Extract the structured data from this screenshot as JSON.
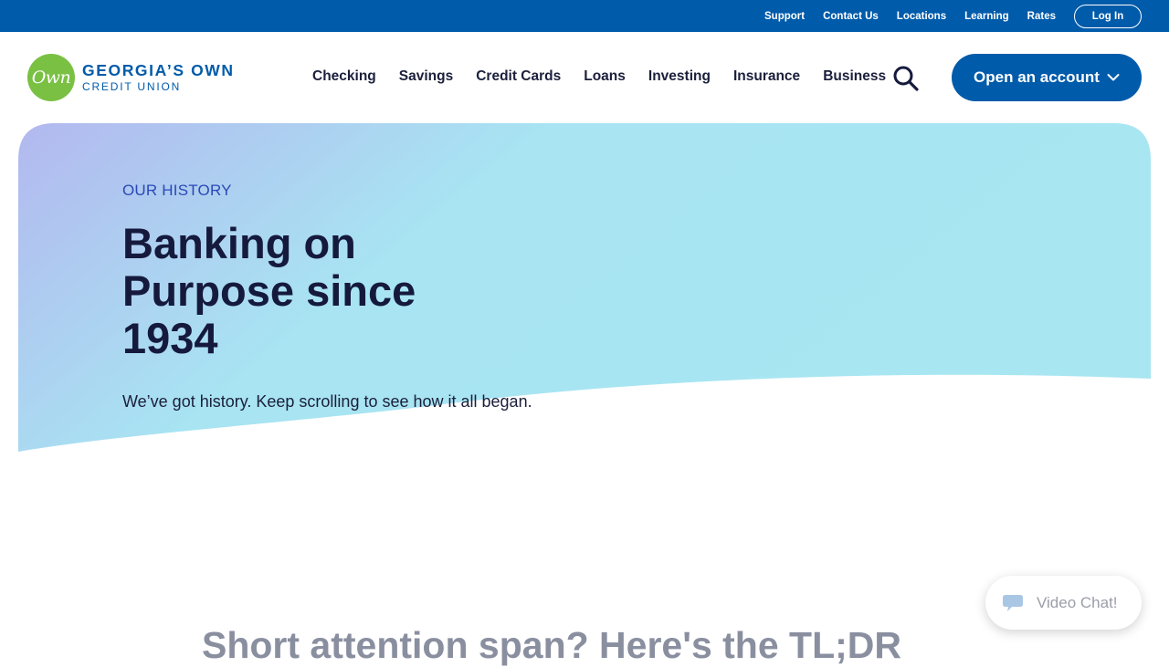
{
  "utility": {
    "links": [
      "Support",
      "Contact Us",
      "Locations",
      "Learning",
      "Rates"
    ],
    "login_label": "Log In"
  },
  "logo": {
    "mark": "Own",
    "line1": "GEORGIA’S OWN",
    "line2": "CREDIT UNION"
  },
  "nav": {
    "items": [
      "Checking",
      "Savings",
      "Credit Cards",
      "Loans",
      "Investing",
      "Insurance",
      "Business"
    ],
    "cta_label": "Open an account"
  },
  "hero": {
    "eyebrow": "OUR HISTORY",
    "title": "Banking on Purpose since 1934",
    "subtitle": "We’ve got history. Keep scrolling to see how it all began."
  },
  "tldr_heading": "Short attention span? Here's the TL;DR",
  "video_chat": {
    "label": "Video Chat!"
  },
  "colors": {
    "brand_blue": "#005baa",
    "logo_green": "#7ac143",
    "eyebrow_blue": "#2a49b5",
    "hero_gradient_start": "#b3b8ef",
    "hero_gradient_end": "#a8e6f2"
  }
}
